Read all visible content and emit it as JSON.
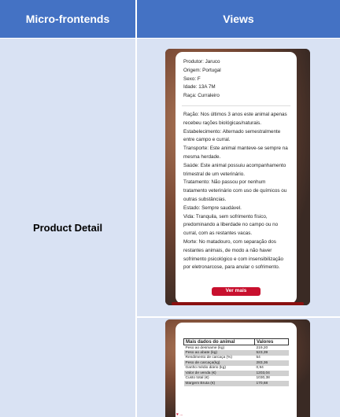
{
  "headers": {
    "col1": "Micro-frontends",
    "col2": "Views"
  },
  "row_label": "Product Detail",
  "detail": {
    "fields": [
      "Produtor: Jaruco",
      "Origem: Portugal",
      "Sexo: F",
      "Idade: 13A 7M",
      "Raça: Curraleiro"
    ],
    "paragraphs": [
      "Ração: Nos últimos 3 anos este animal apenas recebeu rações biológicas/naturais.",
      "Estabelecimento: Alternado semestralmente entre campo e curral.",
      "Transporte: Este animal manteve-se sempre na mesma herdade.",
      "Saúde: Este animal possuiu acompanhamento trimestral de um veterinário.",
      "Tratamento: Não passou por nenhum tratamento veterinário com uso de químicos ou outras substâncias.",
      "Estado: Sempre saudável.",
      "Vida: Tranquila, sem sofrimento físico, predominando a liberdade no campo ou no curral, com as restantes vacas.",
      "Morte: No matadouro, com separação dos restantes animais, de modo a não haver sofrimento psicológico e com insensibilização por eletronarcose, para anular o sofrimento."
    ],
    "button_label": "Ver mais"
  },
  "more_data": {
    "header_label": "Mais dados do animal",
    "header_value": "Valores",
    "rows": [
      {
        "label": "Peso ao desmame (kg)",
        "value": "219,20"
      },
      {
        "label": "Peso ao abate (kg)",
        "value": "523,39"
      },
      {
        "label": "Rendimento de carcaça (%)",
        "value": "54"
      },
      {
        "label": "Peso de carcaça(kg)",
        "value": "283,36"
      },
      {
        "label": "Ganho médio diário (kg)",
        "value": "0,94"
      },
      {
        "label": "Valor de venda (€)",
        "value": "1203,04"
      },
      {
        "label": "Custo total (€)",
        "value": "1030,38"
      },
      {
        "label": "Margem Bruta (€)",
        "value": "170,68"
      }
    ],
    "footer_partial": "♥ ..."
  },
  "colors": {
    "header_blue": "#4472c4",
    "cell_blue": "#d9e2f3",
    "button_red": "#c8102e"
  }
}
